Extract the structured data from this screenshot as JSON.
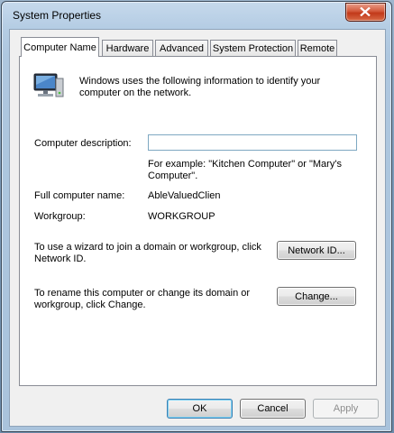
{
  "window": {
    "title": "System Properties"
  },
  "tabs": [
    {
      "label": "Computer Name",
      "active": true
    },
    {
      "label": "Hardware",
      "active": false
    },
    {
      "label": "Advanced",
      "active": false
    },
    {
      "label": "System Protection",
      "active": false
    },
    {
      "label": "Remote",
      "active": false
    }
  ],
  "computer_name_tab": {
    "intro": "Windows uses the following information to identify your computer on the network.",
    "description_label": "Computer description:",
    "description_value": "",
    "example": "For example: \"Kitchen Computer\" or \"Mary's Computer\".",
    "full_name_label": "Full computer name:",
    "full_name_value": "AbleValuedClien",
    "workgroup_label": "Workgroup:",
    "workgroup_value": "WORKGROUP",
    "network_id_text": "To use a wizard to join a domain or workgroup, click Network ID.",
    "network_id_button": "Network ID...",
    "rename_text": "To rename this computer or change its domain or workgroup, click Change.",
    "change_button": "Change..."
  },
  "footer": {
    "ok": "OK",
    "cancel": "Cancel",
    "apply": "Apply"
  },
  "icons": {
    "close": "close-icon",
    "computer": "computer-network-icon"
  }
}
